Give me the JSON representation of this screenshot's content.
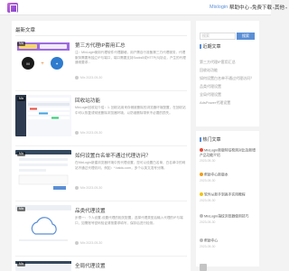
{
  "header": {
    "nav": [
      {
        "label": "Mixlogin",
        "active": true,
        "has_caret": false
      },
      {
        "label": "帮助中心",
        "active": false,
        "has_caret": true
      },
      {
        "label": "免费下载",
        "active": false,
        "has_caret": true
      },
      {
        "label": "其他",
        "active": false,
        "has_caret": true
      }
    ]
  },
  "main": {
    "section_title": "最新文章",
    "posts": [
      {
        "title": "第三方代理IP套用汇总",
        "excerpt": "注：MixLogin使用代理软件代理翻墙，用户需自行准备第三方代理服务，代理服务需要有独立IP与端口，端口需要支持Socks5或HTTP(S)协议，产生的代理通常要求...",
        "meta": "Mix 2023-05-30",
        "badge": "Mix",
        "thumb": "proxy"
      },
      {
        "title": "回收站功能",
        "excerpt": "MixLogin回收站介绍：1. 回收站用来存储被删除的浏览器环境配置，在回收站中可以恢复或彻底删除浏览器环境，以防误删除带来不必要的损失。",
        "meta": "Mix 2023-05-30",
        "badge": "Mix",
        "thumb": "recycle"
      },
      {
        "title": "如何设置白名单不通过代理访问？",
        "excerpt": "在MixLogin新建浏览器环境中的代理设置，您可以设置白名单，白名单中的网站不通过代理访问，例如：*.baidu.com，多个以英文逗号分隔。",
        "meta": "Mix 2023-05-30",
        "badge": "Mix",
        "thumb": "whitelist"
      },
      {
        "title": "品类代理设置",
        "excerpt": "步骤一：个人设置-设置代理的相关配置，选择代理类型后输入代理的IP与端口，如需账号密码验证请按要求填写，保存后进行检测。",
        "meta": "Mix 2023-05-30",
        "badge": "Mix",
        "thumb": "cloud"
      },
      {
        "title": "全局代理设置",
        "excerpt": "",
        "meta": "",
        "badge": "Mix",
        "thumb": "global"
      }
    ]
  },
  "sidebar": {
    "search": {
      "placeholder": "搜索",
      "button_label": "搜索"
    },
    "recent_title": "近期文章",
    "recent": [
      "第三方代理IP套用汇总",
      "回收站功能",
      "如何设置白名单不通过代理访问？",
      "品类代理设置",
      "全局代理设置",
      "AdsPower代理设置"
    ],
    "hot_title": "热门文章",
    "hot": [
      {
        "title": "MixLogin新版特征检测对比及新增产品功能介绍",
        "date": "2023-05-30",
        "color": "#e74c3c"
      },
      {
        "title": "帮助中心新版本",
        "date": "2023-05-30",
        "color": "#f39c12"
      },
      {
        "title": "软件从新手到高手实用教程",
        "date": "2023-05-30",
        "color": "#f1c40f"
      },
      {
        "title": "MixLogin指纹浏览器使用技巧",
        "date": "2023-05-30",
        "color": "#bbbbbb"
      },
      {
        "title": "帮助中心",
        "date": "2023-05-30",
        "color": "#bbbbbb"
      }
    ]
  },
  "colors": {
    "accent": "#5b8fd6",
    "page_bg": "#f3f3f3"
  }
}
